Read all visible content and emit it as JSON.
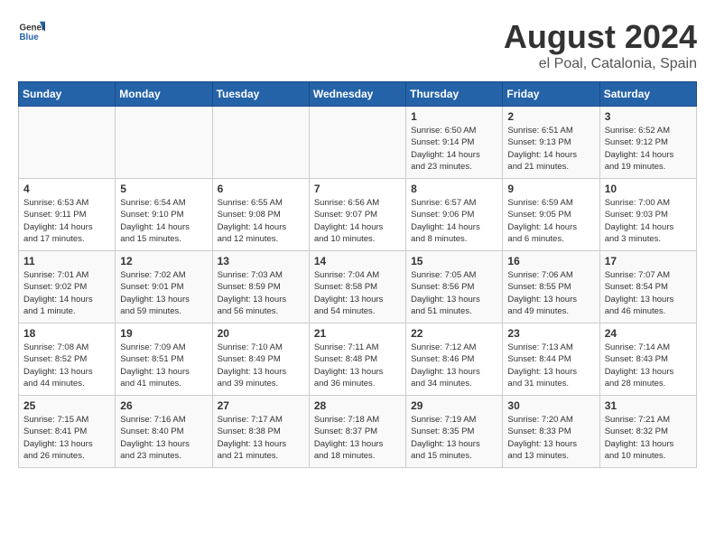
{
  "header": {
    "logo_general": "General",
    "logo_blue": "Blue",
    "main_title": "August 2024",
    "subtitle": "el Poal, Catalonia, Spain"
  },
  "calendar": {
    "days_of_week": [
      "Sunday",
      "Monday",
      "Tuesday",
      "Wednesday",
      "Thursday",
      "Friday",
      "Saturday"
    ],
    "weeks": [
      [
        {
          "day": "",
          "info": ""
        },
        {
          "day": "",
          "info": ""
        },
        {
          "day": "",
          "info": ""
        },
        {
          "day": "",
          "info": ""
        },
        {
          "day": "1",
          "info": "Sunrise: 6:50 AM\nSunset: 9:14 PM\nDaylight: 14 hours\nand 23 minutes."
        },
        {
          "day": "2",
          "info": "Sunrise: 6:51 AM\nSunset: 9:13 PM\nDaylight: 14 hours\nand 21 minutes."
        },
        {
          "day": "3",
          "info": "Sunrise: 6:52 AM\nSunset: 9:12 PM\nDaylight: 14 hours\nand 19 minutes."
        }
      ],
      [
        {
          "day": "4",
          "info": "Sunrise: 6:53 AM\nSunset: 9:11 PM\nDaylight: 14 hours\nand 17 minutes."
        },
        {
          "day": "5",
          "info": "Sunrise: 6:54 AM\nSunset: 9:10 PM\nDaylight: 14 hours\nand 15 minutes."
        },
        {
          "day": "6",
          "info": "Sunrise: 6:55 AM\nSunset: 9:08 PM\nDaylight: 14 hours\nand 12 minutes."
        },
        {
          "day": "7",
          "info": "Sunrise: 6:56 AM\nSunset: 9:07 PM\nDaylight: 14 hours\nand 10 minutes."
        },
        {
          "day": "8",
          "info": "Sunrise: 6:57 AM\nSunset: 9:06 PM\nDaylight: 14 hours\nand 8 minutes."
        },
        {
          "day": "9",
          "info": "Sunrise: 6:59 AM\nSunset: 9:05 PM\nDaylight: 14 hours\nand 6 minutes."
        },
        {
          "day": "10",
          "info": "Sunrise: 7:00 AM\nSunset: 9:03 PM\nDaylight: 14 hours\nand 3 minutes."
        }
      ],
      [
        {
          "day": "11",
          "info": "Sunrise: 7:01 AM\nSunset: 9:02 PM\nDaylight: 14 hours\nand 1 minute."
        },
        {
          "day": "12",
          "info": "Sunrise: 7:02 AM\nSunset: 9:01 PM\nDaylight: 13 hours\nand 59 minutes."
        },
        {
          "day": "13",
          "info": "Sunrise: 7:03 AM\nSunset: 8:59 PM\nDaylight: 13 hours\nand 56 minutes."
        },
        {
          "day": "14",
          "info": "Sunrise: 7:04 AM\nSunset: 8:58 PM\nDaylight: 13 hours\nand 54 minutes."
        },
        {
          "day": "15",
          "info": "Sunrise: 7:05 AM\nSunset: 8:56 PM\nDaylight: 13 hours\nand 51 minutes."
        },
        {
          "day": "16",
          "info": "Sunrise: 7:06 AM\nSunset: 8:55 PM\nDaylight: 13 hours\nand 49 minutes."
        },
        {
          "day": "17",
          "info": "Sunrise: 7:07 AM\nSunset: 8:54 PM\nDaylight: 13 hours\nand 46 minutes."
        }
      ],
      [
        {
          "day": "18",
          "info": "Sunrise: 7:08 AM\nSunset: 8:52 PM\nDaylight: 13 hours\nand 44 minutes."
        },
        {
          "day": "19",
          "info": "Sunrise: 7:09 AM\nSunset: 8:51 PM\nDaylight: 13 hours\nand 41 minutes."
        },
        {
          "day": "20",
          "info": "Sunrise: 7:10 AM\nSunset: 8:49 PM\nDaylight: 13 hours\nand 39 minutes."
        },
        {
          "day": "21",
          "info": "Sunrise: 7:11 AM\nSunset: 8:48 PM\nDaylight: 13 hours\nand 36 minutes."
        },
        {
          "day": "22",
          "info": "Sunrise: 7:12 AM\nSunset: 8:46 PM\nDaylight: 13 hours\nand 34 minutes."
        },
        {
          "day": "23",
          "info": "Sunrise: 7:13 AM\nSunset: 8:44 PM\nDaylight: 13 hours\nand 31 minutes."
        },
        {
          "day": "24",
          "info": "Sunrise: 7:14 AM\nSunset: 8:43 PM\nDaylight: 13 hours\nand 28 minutes."
        }
      ],
      [
        {
          "day": "25",
          "info": "Sunrise: 7:15 AM\nSunset: 8:41 PM\nDaylight: 13 hours\nand 26 minutes."
        },
        {
          "day": "26",
          "info": "Sunrise: 7:16 AM\nSunset: 8:40 PM\nDaylight: 13 hours\nand 23 minutes."
        },
        {
          "day": "27",
          "info": "Sunrise: 7:17 AM\nSunset: 8:38 PM\nDaylight: 13 hours\nand 21 minutes."
        },
        {
          "day": "28",
          "info": "Sunrise: 7:18 AM\nSunset: 8:37 PM\nDaylight: 13 hours\nand 18 minutes."
        },
        {
          "day": "29",
          "info": "Sunrise: 7:19 AM\nSunset: 8:35 PM\nDaylight: 13 hours\nand 15 minutes."
        },
        {
          "day": "30",
          "info": "Sunrise: 7:20 AM\nSunset: 8:33 PM\nDaylight: 13 hours\nand 13 minutes."
        },
        {
          "day": "31",
          "info": "Sunrise: 7:21 AM\nSunset: 8:32 PM\nDaylight: 13 hours\nand 10 minutes."
        }
      ]
    ]
  }
}
